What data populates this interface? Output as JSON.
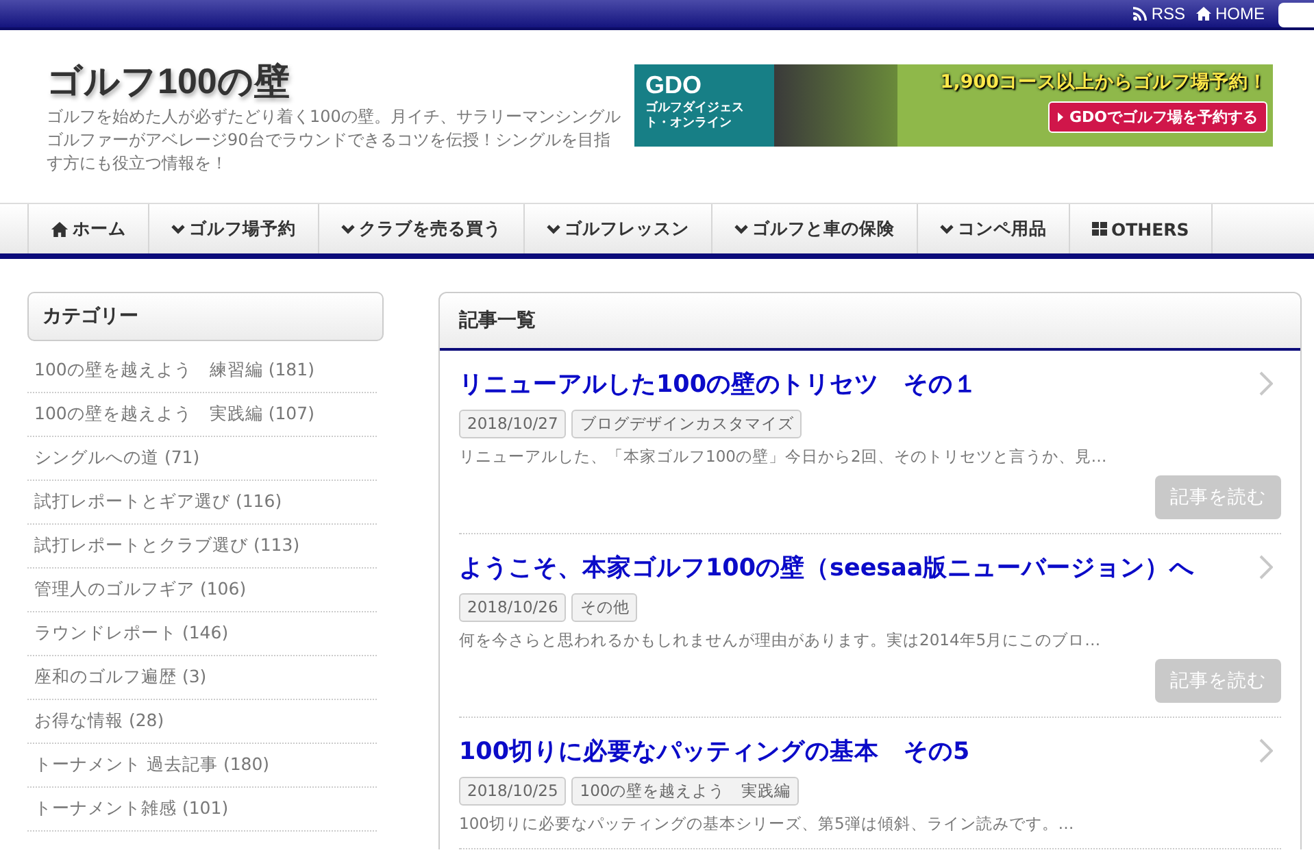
{
  "top_bar": {
    "links": [
      {
        "kind": "rss",
        "label": "RSS"
      },
      {
        "kind": "home",
        "label": "HOME"
      }
    ]
  },
  "header": {
    "title": "ゴルフ100の壁",
    "description": "ゴルフを始めた人が必ずたどり着く100の壁。月イチ、サラリーマンシングルゴルファーがアベレージ90台でラウンドできるコツを伝授！シングルを目指す方にも役立つ情報を！"
  },
  "banner": {
    "logo": "GDO",
    "logo_sub": "ゴルフダイジェスト・オンライン",
    "headline": "1,900コース以上からゴルフ場予約！",
    "button": "GDOでゴルフ場を予約する"
  },
  "nav": [
    {
      "kind": "home",
      "label": "ホーム"
    },
    {
      "kind": "dropdown",
      "label": "ゴルフ場予約"
    },
    {
      "kind": "dropdown",
      "label": "クラブを売る買う"
    },
    {
      "kind": "dropdown",
      "label": "ゴルフレッスン"
    },
    {
      "kind": "dropdown",
      "label": "ゴルフと車の保険"
    },
    {
      "kind": "dropdown",
      "label": "コンペ用品"
    },
    {
      "kind": "grid",
      "label": "OTHERS"
    }
  ],
  "sidebar": {
    "title": "カテゴリー",
    "items": [
      "100の壁を越えよう　練習編 (181)",
      "100の壁を越えよう　実践編 (107)",
      "シングルへの道 (71)",
      "試打レポートとギア選び (116)",
      "試打レポートとクラブ選び (113)",
      "管理人のゴルフギア (106)",
      "ラウンドレポート (146)",
      "座和のゴルフ遍歴 (3)",
      "お得な情報 (28)",
      "トーナメント 過去記事 (180)",
      "トーナメント雑感 (101)"
    ]
  },
  "main": {
    "title": "記事一覧",
    "articles": [
      {
        "title": "リニューアルした100の壁のトリセツ　その１",
        "date": "2018/10/27",
        "category": "ブログデザインカスタマイズ",
        "excerpt": "リニューアルした、「本家ゴルフ100の壁」今日から2回、そのトリセツと言うか、見…",
        "button": "記事を読む"
      },
      {
        "title": "ようこそ、本家ゴルフ100の壁（seesaa版ニューバージョン）へ",
        "date": "2018/10/26",
        "category": "その他",
        "excerpt": "何を今さらと思われるかもしれませんが理由があります。実は2014年5月にこのブロ…",
        "button": "記事を読む"
      },
      {
        "title": "100切りに必要なパッティングの基本　その5",
        "date": "2018/10/25",
        "category": "100の壁を越えよう　実践編",
        "excerpt": "100切りに必要なパッティングの基本シリーズ、第5弾は傾斜、ライン読みです。…"
      }
    ]
  }
}
